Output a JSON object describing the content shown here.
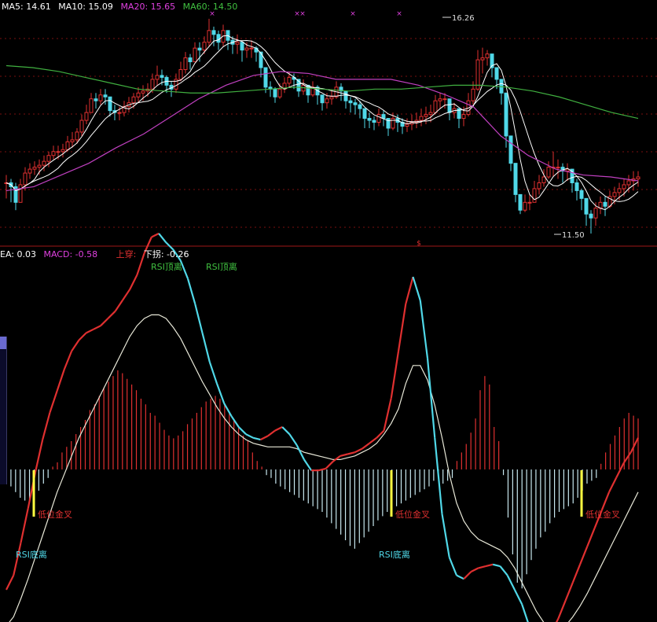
{
  "price_panel": {
    "legend": [
      {
        "label": "MA5: 14.61",
        "color": "#ffffff"
      },
      {
        "label": "MA10: 15.09",
        "color": "#ffffff"
      },
      {
        "label": "MA20: 15.65",
        "color": "#e040e0"
      },
      {
        "label": "MA60: 14.50",
        "color": "#40c040"
      }
    ],
    "high_label": "16.26",
    "low_label": "11.50"
  },
  "macd_panel": {
    "legend": [
      {
        "label": "EA: 0.03",
        "color": "#ffffff"
      },
      {
        "label": "MACD: -0.58",
        "color": "#e040e0"
      },
      {
        "label": "上穿:",
        "color": "#e03030"
      },
      {
        "label": "下拐: -0.26",
        "color": "#ffffff"
      }
    ]
  },
  "annotations": {
    "rsi_top_1": "RSI顶离",
    "rsi_top_2": "RSI顶离",
    "golden_cross_1": "低位金叉",
    "golden_cross_2": "低位金叉",
    "golden_cross_3": "低位金叉",
    "rsi_bottom_1": "RSI底离",
    "rsi_bottom_2": "RSI底离"
  },
  "colors": {
    "up": "#e03030",
    "down": "#50d8e8",
    "ma5": "#ffffff",
    "ma10": "#ffffff",
    "ma20": "#c040c0",
    "ma60": "#40b040",
    "signal": "#ffff40",
    "grid": "#7a1010"
  },
  "chart_data": [
    {
      "type": "candlestick",
      "x": [
        1,
        2,
        3,
        4,
        5,
        6,
        7,
        8,
        9,
        10,
        11,
        12,
        13,
        14,
        15,
        16,
        17,
        18,
        19,
        20,
        21,
        22,
        23,
        24,
        25,
        26,
        27,
        28,
        29,
        30,
        31,
        32,
        33,
        34,
        35,
        36,
        37,
        38,
        39,
        40,
        41,
        42,
        43,
        44,
        45,
        46,
        47,
        48,
        49,
        50,
        51,
        52,
        53,
        54,
        55,
        56,
        57,
        58,
        59,
        60,
        61,
        62,
        63,
        64,
        65,
        66,
        67,
        68,
        69,
        70,
        71,
        72,
        73,
        74,
        75,
        76,
        77,
        78,
        79,
        80,
        81,
        82,
        83,
        84,
        85,
        86,
        87,
        88,
        89,
        90,
        91,
        92,
        93,
        94,
        95,
        96,
        97,
        98,
        99,
        100,
        101,
        102,
        103,
        104,
        105,
        106,
        107,
        108,
        109,
        110,
        111,
        112,
        113,
        114,
        115,
        116,
        117,
        118,
        119,
        120,
        121,
        122,
        123,
        124,
        125,
        126,
        127,
        128,
        129,
        130,
        131,
        132,
        133,
        134,
        135
      ],
      "close": [
        12.8,
        12.7,
        12.3,
        12.75,
        13.05,
        13.15,
        13.2,
        13.25,
        13.35,
        13.5,
        13.6,
        13.6,
        13.65,
        13.85,
        13.9,
        14.1,
        14.4,
        14.6,
        14.95,
        14.9,
        15.05,
        15.0,
        14.65,
        14.6,
        14.6,
        14.75,
        14.85,
        15.0,
        15.1,
        15.15,
        15.2,
        15.45,
        15.55,
        15.5,
        15.3,
        15.2,
        15.45,
        15.7,
        16.0,
        15.9,
        16.25,
        16.2,
        16.4,
        16.7,
        16.6,
        16.4,
        16.7,
        16.45,
        16.35,
        16.4,
        16.2,
        16.25,
        16.25,
        16.15,
        15.75,
        15.25,
        15.2,
        15.0,
        15.2,
        15.35,
        15.5,
        15.45,
        15.15,
        15.3,
        15.05,
        15.25,
        15.05,
        14.85,
        14.95,
        15.0,
        15.25,
        15.15,
        14.9,
        14.85,
        14.8,
        14.7,
        14.45,
        14.4,
        14.35,
        14.55,
        14.45,
        14.2,
        14.45,
        14.35,
        14.25,
        14.3,
        14.35,
        14.4,
        14.5,
        14.55,
        14.6,
        14.9,
        14.95,
        14.95,
        14.6,
        14.7,
        14.45,
        14.55,
        14.9,
        15.2,
        15.95,
        16.0,
        16.1,
        15.75,
        15.45,
        15.1,
        14.0,
        13.3,
        12.5,
        12.1,
        12.3,
        12.3,
        12.65,
        12.8,
        12.95,
        13.2,
        13.2,
        13.2,
        13.1,
        13.15,
        12.8,
        12.6,
        12.4,
        12.0,
        11.9,
        12.15,
        12.3,
        12.2,
        12.45,
        12.55,
        12.65,
        12.75,
        12.85,
        12.9,
        12.95
      ],
      "high": [
        13.0,
        12.9,
        12.8,
        12.9,
        13.2,
        13.3,
        13.35,
        13.4,
        13.5,
        13.6,
        13.75,
        13.75,
        13.8,
        14.0,
        14.1,
        14.2,
        14.55,
        14.8,
        15.1,
        15.1,
        15.2,
        15.2,
        15.0,
        14.8,
        14.75,
        14.9,
        15.0,
        15.1,
        15.25,
        15.3,
        15.35,
        15.6,
        15.8,
        15.7,
        15.55,
        15.4,
        15.6,
        15.9,
        16.15,
        16.1,
        16.4,
        16.4,
        16.55,
        17.0,
        16.8,
        16.7,
        16.85,
        16.7,
        16.55,
        16.6,
        16.4,
        16.4,
        16.45,
        16.3,
        16.0,
        15.6,
        15.4,
        15.25,
        15.35,
        15.5,
        15.65,
        15.6,
        15.4,
        15.45,
        15.3,
        15.4,
        15.3,
        15.05,
        15.1,
        15.2,
        15.4,
        15.35,
        15.1,
        15.0,
        14.95,
        14.9,
        14.7,
        14.6,
        14.5,
        14.7,
        14.65,
        14.4,
        14.6,
        14.55,
        14.45,
        14.45,
        14.55,
        14.6,
        14.7,
        14.75,
        14.8,
        15.05,
        15.1,
        15.1,
        14.85,
        14.85,
        14.7,
        14.75,
        15.1,
        15.4,
        16.2,
        16.26,
        16.2,
        15.95,
        15.7,
        15.3,
        14.7,
        13.8,
        13.1,
        12.5,
        12.5,
        12.5,
        12.85,
        13.0,
        13.15,
        13.35,
        13.6,
        13.4,
        13.3,
        13.3,
        13.1,
        12.9,
        12.65,
        12.3,
        12.1,
        12.3,
        12.45,
        12.45,
        12.6,
        12.7,
        12.8,
        12.9,
        13.0,
        13.1,
        13.1
      ],
      "low": [
        12.4,
        12.3,
        12.1,
        12.4,
        12.6,
        12.9,
        13.0,
        13.0,
        13.1,
        13.2,
        13.4,
        13.4,
        13.45,
        13.6,
        13.7,
        13.8,
        14.0,
        14.3,
        14.6,
        14.7,
        14.8,
        14.8,
        14.5,
        14.4,
        14.4,
        14.5,
        14.6,
        14.7,
        14.85,
        14.9,
        15.0,
        15.1,
        15.3,
        15.3,
        15.1,
        15.0,
        15.1,
        15.4,
        15.6,
        15.7,
        15.9,
        15.9,
        16.1,
        16.3,
        16.3,
        16.2,
        16.3,
        16.2,
        16.1,
        16.1,
        15.9,
        16.0,
        16.0,
        15.9,
        15.5,
        15.1,
        15.0,
        14.85,
        14.95,
        15.1,
        15.25,
        15.2,
        15.0,
        15.05,
        14.85,
        15.0,
        14.8,
        14.65,
        14.7,
        14.8,
        14.95,
        14.9,
        14.7,
        14.6,
        14.55,
        14.45,
        14.2,
        14.2,
        14.15,
        14.25,
        14.25,
        14.0,
        14.15,
        14.1,
        14.05,
        14.1,
        14.15,
        14.2,
        14.25,
        14.3,
        14.35,
        14.55,
        14.7,
        14.7,
        14.4,
        14.45,
        14.2,
        14.25,
        14.5,
        14.8,
        15.15,
        15.6,
        15.8,
        15.5,
        15.2,
        14.8,
        13.7,
        13.1,
        12.3,
        12.0,
        12.05,
        12.1,
        12.3,
        12.5,
        12.7,
        12.9,
        12.95,
        12.9,
        12.8,
        12.85,
        12.55,
        12.35,
        12.1,
        11.7,
        11.5,
        11.7,
        12.0,
        11.95,
        12.15,
        12.25,
        12.35,
        12.45,
        12.55,
        12.6,
        12.7
      ],
      "ylim": [
        11.4,
        17.2
      ],
      "legend": [
        "MA5: 14.61",
        "MA10: 15.09",
        "MA20: 15.65",
        "MA60: 14.50"
      ],
      "annotations": [
        "16.26",
        "11.50"
      ],
      "ma20": [
        12.6,
        12.7,
        13.0,
        13.3,
        13.7,
        14.05,
        14.5,
        14.95,
        15.3,
        15.55,
        15.65,
        15.6,
        15.45,
        15.45,
        15.45,
        15.3,
        15.05,
        14.75,
        14.0,
        13.5,
        13.15,
        13.0,
        12.95,
        12.85
      ],
      "ma60": [
        15.8,
        15.75,
        15.65,
        15.5,
        15.35,
        15.2,
        15.15,
        15.1,
        15.1,
        15.15,
        15.2,
        15.25,
        15.2,
        15.15,
        15.2,
        15.2,
        15.25,
        15.3,
        15.3,
        15.25,
        15.15,
        15.0,
        14.8,
        14.6,
        14.45
      ]
    },
    {
      "type": "macd",
      "series": [
        {
          "values": [
            -0.08,
            -0.12,
            -0.16,
            -0.2,
            -0.22,
            -0.22,
            -0.2,
            -0.15,
            -0.1,
            -0.06,
            0.02,
            0.05,
            0.12,
            0.16,
            0.2,
            0.25,
            0.3,
            0.35,
            0.42,
            0.46,
            0.52,
            0.58,
            0.62,
            0.66,
            0.7,
            0.68,
            0.64,
            0.6,
            0.56,
            0.5,
            0.46,
            0.4,
            0.38,
            0.33,
            0.28,
            0.24,
            0.22,
            0.24,
            0.27,
            0.32,
            0.36,
            0.4,
            0.44,
            0.48,
            0.5,
            0.52,
            0.5,
            0.46,
            0.4,
            0.35,
            0.3,
            0.24,
            0.2,
            0.12,
            0.06,
            0.02,
            -0.04,
            -0.06,
            -0.1,
            -0.12,
            -0.14,
            -0.16,
            -0.18,
            -0.2,
            -0.22,
            -0.24,
            -0.26,
            -0.28,
            -0.3,
            -0.34,
            -0.38,
            -0.42,
            -0.46,
            -0.5,
            -0.54,
            -0.56,
            -0.52,
            -0.48,
            -0.44,
            -0.4,
            -0.36,
            -0.33,
            -0.3,
            -0.28,
            -0.26,
            -0.24,
            -0.22,
            -0.2,
            -0.18,
            -0.16,
            -0.14,
            -0.12,
            -0.08,
            -0.04,
            -0.1,
            -0.08,
            -0.06,
            0.06,
            0.12,
            0.18,
            0.26,
            0.36,
            0.56,
            0.66,
            0.6,
            0.3,
            0.2,
            -0.04,
            -0.34,
            -0.6,
            -0.8,
            -0.84,
            -0.74,
            -0.64,
            -0.56,
            -0.48,
            -0.44,
            -0.38,
            -0.34,
            -0.3,
            -0.28,
            -0.26,
            -0.24,
            -0.2,
            -0.15,
            -0.1,
            -0.08,
            -0.06,
            0.04,
            0.12,
            0.18,
            0.24,
            0.3,
            0.36,
            0.4,
            0.38,
            0.36
          ]
        }
      ],
      "dif": [
        -1.0,
        -0.92,
        -0.74,
        -0.55,
        -0.35,
        -0.17,
        -0.02,
        0.1,
        0.22,
        0.32,
        0.38,
        0.42,
        0.44,
        0.46,
        0.5,
        0.54,
        0.6,
        0.66,
        0.74,
        0.86,
        0.95,
        0.97,
        0.92,
        0.88,
        0.82,
        0.72,
        0.58,
        0.42,
        0.26,
        0.14,
        0.03,
        -0.04,
        -0.1,
        -0.14,
        -0.16,
        -0.17,
        -0.15,
        -0.12,
        -0.1,
        -0.14,
        -0.2,
        -0.28,
        -0.34,
        -0.34,
        -0.33,
        -0.29,
        -0.26,
        -0.25,
        -0.24,
        -0.22,
        -0.19,
        -0.16,
        -0.12,
        0.06,
        0.32,
        0.58,
        0.73,
        0.6,
        0.28,
        -0.16,
        -0.58,
        -0.82,
        -0.92,
        -0.94,
        -0.9,
        -0.88,
        -0.87,
        -0.86,
        -0.87,
        -0.92,
        -1.0,
        -1.08,
        -1.2,
        -1.26,
        -1.28,
        -1.24,
        -1.16,
        -1.06,
        -0.96,
        -0.86,
        -0.76,
        -0.66,
        -0.56,
        -0.46,
        -0.38,
        -0.3,
        -0.24,
        -0.16
      ],
      "dea": [
        -1.2,
        -1.15,
        -1.05,
        -0.94,
        -0.82,
        -0.7,
        -0.58,
        -0.46,
        -0.36,
        -0.26,
        -0.16,
        -0.08,
        0.0,
        0.08,
        0.16,
        0.24,
        0.32,
        0.4,
        0.46,
        0.5,
        0.52,
        0.52,
        0.5,
        0.45,
        0.39,
        0.31,
        0.23,
        0.15,
        0.08,
        0.01,
        -0.05,
        -0.1,
        -0.14,
        -0.17,
        -0.19,
        -0.2,
        -0.21,
        -0.21,
        -0.21,
        -0.21,
        -0.22,
        -0.24,
        -0.25,
        -0.26,
        -0.27,
        -0.28,
        -0.28,
        -0.27,
        -0.26,
        -0.24,
        -0.22,
        -0.19,
        -0.14,
        -0.08,
        0.0,
        0.14,
        0.24,
        0.24,
        0.16,
        0.02,
        -0.16,
        -0.36,
        -0.52,
        -0.62,
        -0.68,
        -0.72,
        -0.74,
        -0.76,
        -0.78,
        -0.82,
        -0.88,
        -0.96,
        -1.04,
        -1.12,
        -1.18,
        -1.22,
        -1.22,
        -1.2,
        -1.15,
        -1.09,
        -1.02,
        -0.94,
        -0.86,
        -0.78,
        -0.7,
        -0.62,
        -0.54,
        -0.46
      ],
      "ylim": [
        -1.3,
        1.0
      ],
      "legend": [
        "EA: 0.03",
        "MACD: -0.58",
        "上穿:",
        "下拐: -0.26"
      ],
      "annotations": [
        "RSI顶离",
        "RSI顶离",
        "低位金叉",
        "低位金叉",
        "低位金叉",
        "RSI底离",
        "RSI底离"
      ]
    }
  ]
}
